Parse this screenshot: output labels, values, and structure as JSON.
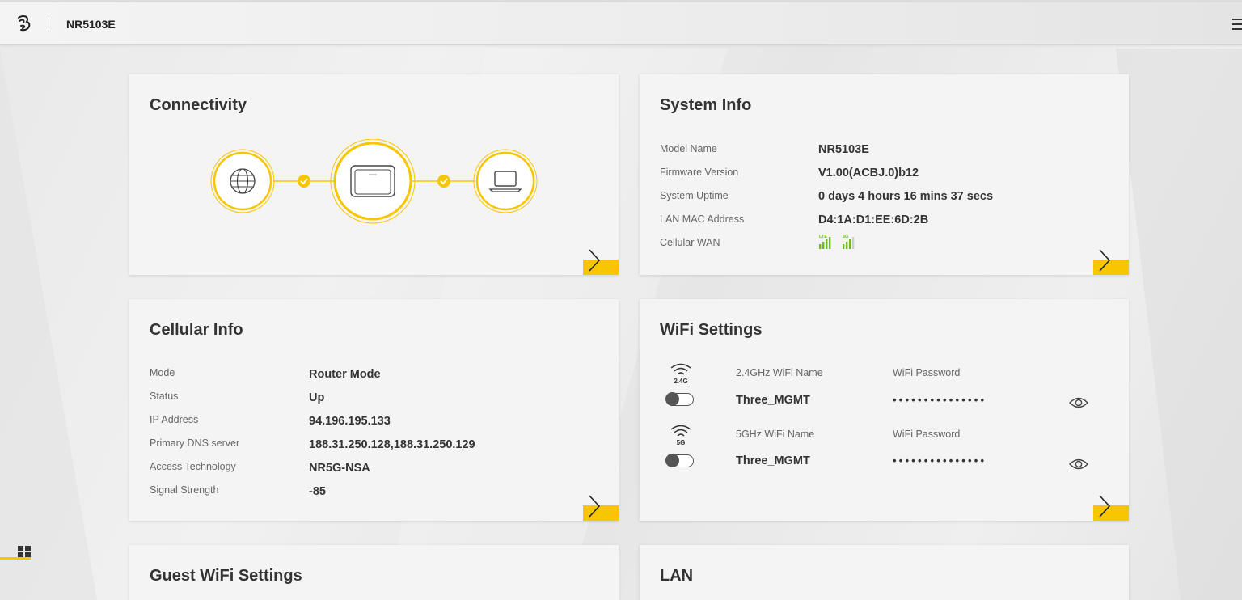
{
  "header": {
    "logo": "three-logo",
    "model": "NR5103E"
  },
  "connectivity": {
    "title": "Connectivity",
    "nodes": [
      "globe-icon",
      "router-icon",
      "laptop-icon"
    ],
    "accent": "#f7c600"
  },
  "system_info": {
    "title": "System Info",
    "rows": [
      {
        "label": "Model Name",
        "value": "NR5103E"
      },
      {
        "label": "Firmware Version",
        "value": "V1.00(ACBJ.0)b12"
      },
      {
        "label": "System Uptime",
        "value": "0 days 4 hours 16 mins 37 secs"
      },
      {
        "label": "LAN MAC Address",
        "value": "D4:1A:D1:EE:6D:2B"
      },
      {
        "label": "Cellular WAN",
        "value": ""
      }
    ],
    "signal": {
      "lte_label": "LTE",
      "nr_label": "5G",
      "lte_bars": 4,
      "nr_bars": 3,
      "color": "#6dbb1e"
    }
  },
  "cellular_info": {
    "title": "Cellular Info",
    "rows": [
      {
        "label": "Mode",
        "value": "Router Mode"
      },
      {
        "label": "Status",
        "value": "Up"
      },
      {
        "label": "IP Address",
        "value": "94.196.195.133"
      },
      {
        "label": "Primary DNS server",
        "value": "188.31.250.128,188.31.250.129"
      },
      {
        "label": "Access Technology",
        "value": "NR5G-NSA"
      },
      {
        "label": "Signal Strength",
        "value": "-85"
      }
    ]
  },
  "wifi_settings": {
    "title": "WiFi Settings",
    "bands": [
      {
        "band_label": "2.4G",
        "name_label": "2.4GHz WiFi Name",
        "name": "Three_MGMT",
        "pw_label": "WiFi Password",
        "pw": "•••••••••••••••"
      },
      {
        "band_label": "5G",
        "name_label": "5GHz WiFi Name",
        "name": "Three_MGMT",
        "pw_label": "WiFi Password",
        "pw": "•••••••••••••••"
      }
    ]
  },
  "guest_wifi": {
    "title": "Guest WiFi Settings"
  },
  "lan": {
    "title": "LAN"
  }
}
